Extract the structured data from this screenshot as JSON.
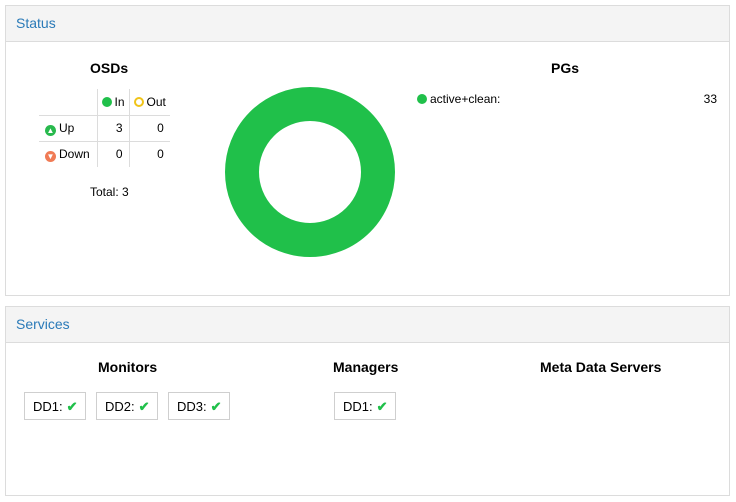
{
  "status": {
    "title": "Status",
    "osds": {
      "title": "OSDs",
      "col_in": "In",
      "col_out": "Out",
      "rows": [
        {
          "label": "Up",
          "in": "3",
          "out": "0"
        },
        {
          "label": "Down",
          "in": "0",
          "out": "0"
        }
      ],
      "total": "Total: 3"
    },
    "pgs": {
      "title": "PGs",
      "legend": [
        {
          "label": "active+clean:",
          "value": "33",
          "color": "#20c04a"
        }
      ],
      "donut": [
        {
          "state": "active+clean",
          "count": 33,
          "color": "#20c04a"
        }
      ]
    }
  },
  "services": {
    "title": "Services",
    "monitors": {
      "title": "Monitors",
      "items": [
        "DD1:",
        "DD2:",
        "DD3:"
      ]
    },
    "managers": {
      "title": "Managers",
      "items": [
        "DD1:"
      ]
    },
    "mds": {
      "title": "Meta Data Servers",
      "items": []
    }
  },
  "colors": {
    "accent": "#2a7ab8",
    "ok": "#20c04a",
    "out": "#f0c419",
    "down": "#f07b55"
  }
}
